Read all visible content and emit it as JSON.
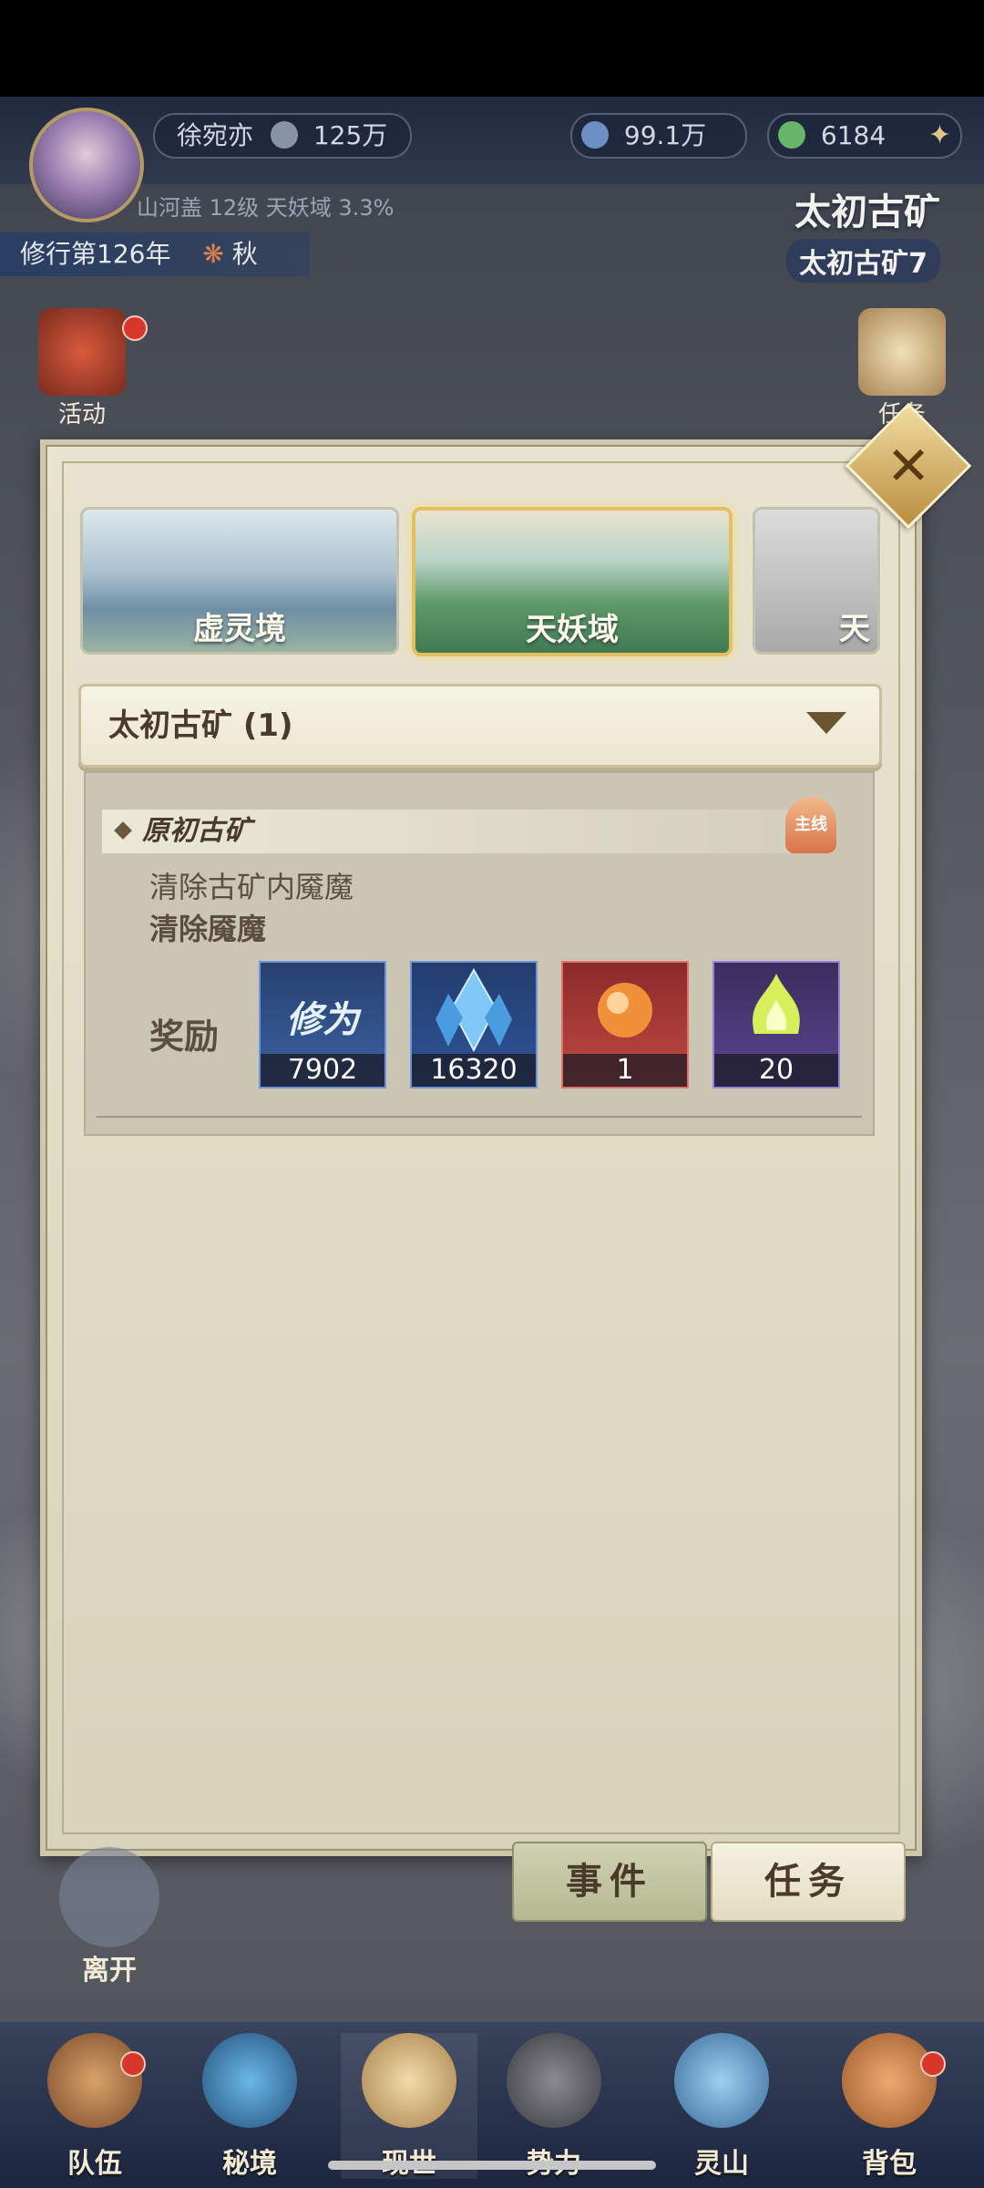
{
  "player": {
    "name": "徐宛亦",
    "power": "125万",
    "spirit_stones": "99.1万",
    "jade": "6184",
    "realm_line": "山河盖 12级 天妖域 3.3%",
    "year": "修行第126年",
    "season": "秋"
  },
  "location": {
    "title": "太初古矿",
    "sub": "太初古矿7"
  },
  "side": {
    "activity": "活动",
    "task": "任务"
  },
  "realms": [
    {
      "label": "虚灵境"
    },
    {
      "label": "天妖域"
    },
    {
      "label": "天"
    }
  ],
  "dropdown": {
    "label": "太初古矿 (1)"
  },
  "task": {
    "name": "原初古矿",
    "tag": "主线",
    "description": "清除古矿内魇魔",
    "objective": "清除魇魔",
    "reward_label": "奖励",
    "rewards": [
      {
        "icon": "cultivation-icon",
        "icon_text": "修为",
        "count": "7902"
      },
      {
        "icon": "crystal-icon",
        "count": "16320"
      },
      {
        "icon": "fire-orb-icon",
        "count": "1"
      },
      {
        "icon": "green-flame-icon",
        "count": "20"
      }
    ]
  },
  "tabs": {
    "events": "事件",
    "tasks": "任务"
  },
  "leave": "离开",
  "nav": [
    {
      "label": "队伍"
    },
    {
      "label": "秘境"
    },
    {
      "label": "现世"
    },
    {
      "label": "势力"
    },
    {
      "label": "灵山"
    },
    {
      "label": "背包"
    }
  ],
  "colors": {
    "accent": "#b98d3e",
    "panel": "#e8e3cf",
    "text": "#4a3a2a"
  }
}
